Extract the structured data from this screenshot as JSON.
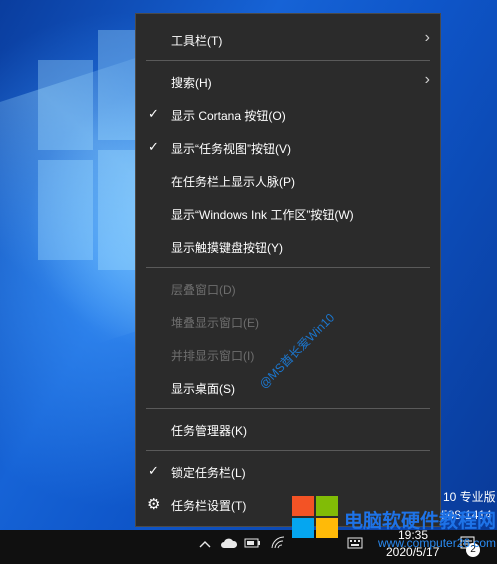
{
  "menu": {
    "items": [
      {
        "label": "工具栏(T)",
        "check": false,
        "submenu": true,
        "disabled": false
      },
      {
        "label": "搜索(H)",
        "check": false,
        "submenu": true,
        "disabled": false
      },
      {
        "label": "显示 Cortana 按钮(O)",
        "check": true,
        "submenu": false,
        "disabled": false
      },
      {
        "label": "显示“任务视图”按钮(V)",
        "check": true,
        "submenu": false,
        "disabled": false
      },
      {
        "label": "在任务栏上显示人脉(P)",
        "check": false,
        "submenu": false,
        "disabled": false
      },
      {
        "label": "显示“Windows Ink 工作区”按钮(W)",
        "check": false,
        "submenu": false,
        "disabled": false
      },
      {
        "label": "显示触摸键盘按钮(Y)",
        "check": false,
        "submenu": false,
        "disabled": false
      },
      {
        "label": "层叠窗口(D)",
        "check": false,
        "submenu": false,
        "disabled": true
      },
      {
        "label": "堆叠显示窗口(E)",
        "check": false,
        "submenu": false,
        "disabled": true
      },
      {
        "label": "并排显示窗口(I)",
        "check": false,
        "submenu": false,
        "disabled": true
      },
      {
        "label": "显示桌面(S)",
        "check": false,
        "submenu": false,
        "disabled": false
      },
      {
        "label": "任务管理器(K)",
        "check": false,
        "submenu": false,
        "disabled": false
      },
      {
        "label": "锁定任务栏(L)",
        "check": true,
        "submenu": false,
        "disabled": false
      },
      {
        "label": "任务栏设置(T)",
        "check": false,
        "submenu": false,
        "disabled": false
      }
    ],
    "check_glyph": "✓",
    "arrow_glyph": "›",
    "gear_glyph": "⚙"
  },
  "watermark": "@MS酋长爱Win10",
  "desktop_text": {
    "edition": "10 专业版",
    "build": "508-1414"
  },
  "taskbar": {
    "time": "19:35",
    "date": "2020/5/17",
    "notification_count": "2",
    "icons": [
      "chevron-up-icon",
      "cloud-icon",
      "battery-icon",
      "wifi-icon",
      "keyboard-icon",
      "notification-icon"
    ]
  },
  "logo": {
    "title": "电脑软硬件教程网",
    "url": "www.computer26.com"
  },
  "colors": {
    "menu_bg": "#2b2b2b",
    "disabled_text": "#6e6e6e",
    "accent": "#1e73e8"
  }
}
